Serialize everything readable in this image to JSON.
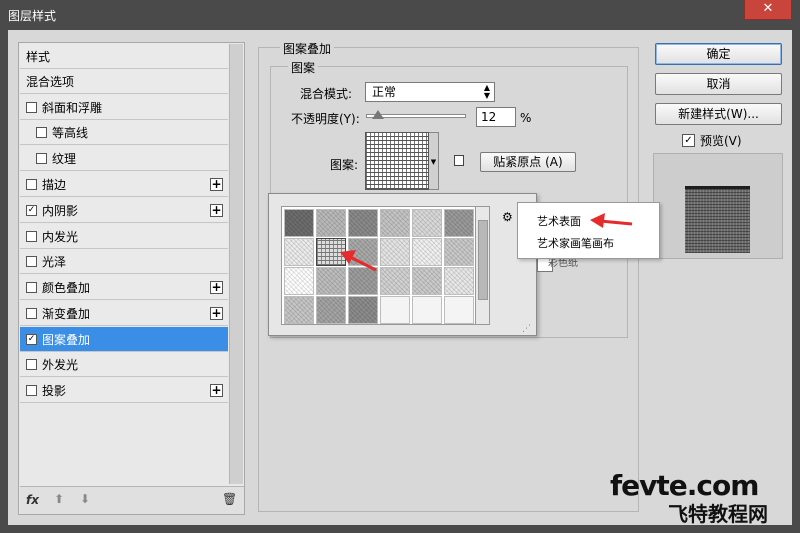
{
  "window": {
    "title": "图层样式",
    "close_label": "✕"
  },
  "styles_list": {
    "items": [
      {
        "label": "样式",
        "checkbox": false,
        "checked": false,
        "plus": false,
        "indent": 0,
        "selected": false
      },
      {
        "label": "混合选项",
        "checkbox": false,
        "checked": false,
        "plus": false,
        "indent": 0,
        "selected": false
      },
      {
        "label": "斜面和浮雕",
        "checkbox": true,
        "checked": false,
        "plus": false,
        "indent": 0,
        "selected": false
      },
      {
        "label": "等高线",
        "checkbox": true,
        "checked": false,
        "plus": false,
        "indent": 1,
        "selected": false
      },
      {
        "label": "纹理",
        "checkbox": true,
        "checked": false,
        "plus": false,
        "indent": 1,
        "selected": false
      },
      {
        "label": "描边",
        "checkbox": true,
        "checked": false,
        "plus": true,
        "indent": 0,
        "selected": false
      },
      {
        "label": "内阴影",
        "checkbox": true,
        "checked": true,
        "plus": true,
        "indent": 0,
        "selected": false
      },
      {
        "label": "内发光",
        "checkbox": true,
        "checked": false,
        "plus": false,
        "indent": 0,
        "selected": false
      },
      {
        "label": "光泽",
        "checkbox": true,
        "checked": false,
        "plus": false,
        "indent": 0,
        "selected": false
      },
      {
        "label": "颜色叠加",
        "checkbox": true,
        "checked": false,
        "plus": true,
        "indent": 0,
        "selected": false
      },
      {
        "label": "渐变叠加",
        "checkbox": true,
        "checked": false,
        "plus": true,
        "indent": 0,
        "selected": false
      },
      {
        "label": "图案叠加",
        "checkbox": true,
        "checked": true,
        "plus": false,
        "indent": 0,
        "selected": true
      },
      {
        "label": "外发光",
        "checkbox": true,
        "checked": false,
        "plus": false,
        "indent": 0,
        "selected": false
      },
      {
        "label": "投影",
        "checkbox": true,
        "checked": false,
        "plus": true,
        "indent": 0,
        "selected": false
      }
    ],
    "footer": {
      "fx_label": "fx",
      "up_icon": "arrow-up-icon",
      "down_icon": "arrow-down-icon",
      "trash_icon": "trash-icon"
    }
  },
  "pattern_overlay": {
    "section_title": "图案叠加",
    "group_title": "图案",
    "blend_mode_label": "混合模式:",
    "blend_mode_value": "正常",
    "opacity_label": "不透明度(Y):",
    "opacity_value": "12",
    "opacity_unit": "%",
    "opacity_level": 0.12,
    "pattern_label": "图案:",
    "snap_button": "贴紧原点 (A)"
  },
  "pattern_picker": {
    "tile_count": 24,
    "gear_icon": "gear-icon",
    "menu_items": [
      "艺术表面",
      "艺术家画笔画布"
    ],
    "partial_item": "彩色纸"
  },
  "actions": {
    "ok": "确定",
    "cancel": "取消",
    "new_style": "新建样式(W)...",
    "preview_label": "预览(V)",
    "preview_checked": true
  },
  "watermark": {
    "main": "fevte.com",
    "sub": "飞特教程网"
  },
  "colors": {
    "selection": "#3a8ee6",
    "arrow": "#e52b2b",
    "titlebar": "#4a4a4a"
  }
}
